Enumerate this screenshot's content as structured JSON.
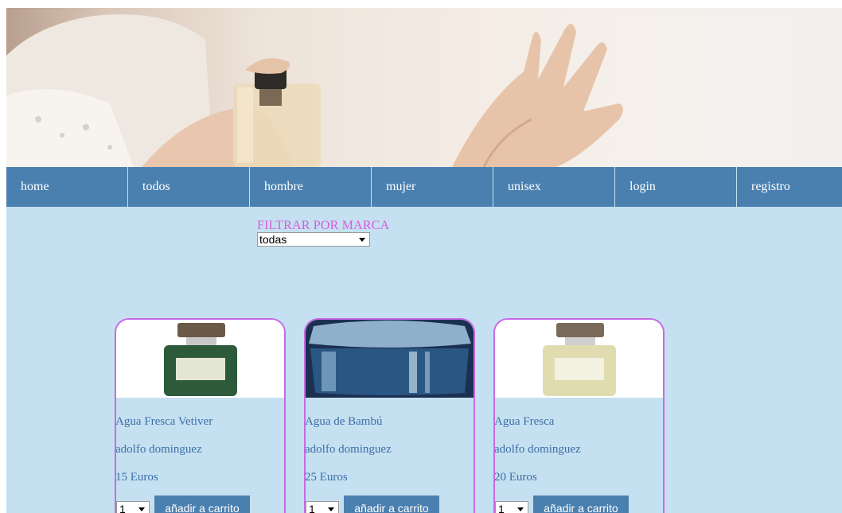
{
  "nav": {
    "items": [
      {
        "label": "home"
      },
      {
        "label": "todos"
      },
      {
        "label": "hombre"
      },
      {
        "label": "mujer"
      },
      {
        "label": "unisex"
      },
      {
        "label": "login"
      },
      {
        "label": "registro"
      }
    ]
  },
  "filter": {
    "label": "FILTRAR POR MARCA",
    "selected": "todas"
  },
  "products": [
    {
      "name": "Agua Fresca Vetiver",
      "brand": "adolfo dominguez",
      "price": "15 Euros",
      "qty": "1",
      "button": "añadir a carrito",
      "bottle_color": "#2d5a3a"
    },
    {
      "name": "Agua de Bambú",
      "brand": "adolfo dominguez",
      "price": "25 Euros",
      "qty": "1",
      "button": "añadir a carrito",
      "bottle_color": "#1e3f66"
    },
    {
      "name": "Agua Fresca",
      "brand": "adolfo dominguez",
      "price": "20 Euros",
      "qty": "1",
      "button": "añadir a carrito",
      "bottle_color": "#e0dcb0"
    }
  ],
  "colors": {
    "nav_bg": "#4a80b0",
    "page_bg": "#c5e0f0",
    "accent_pink": "#c86ae6",
    "text_blue": "#3d6fa8"
  }
}
